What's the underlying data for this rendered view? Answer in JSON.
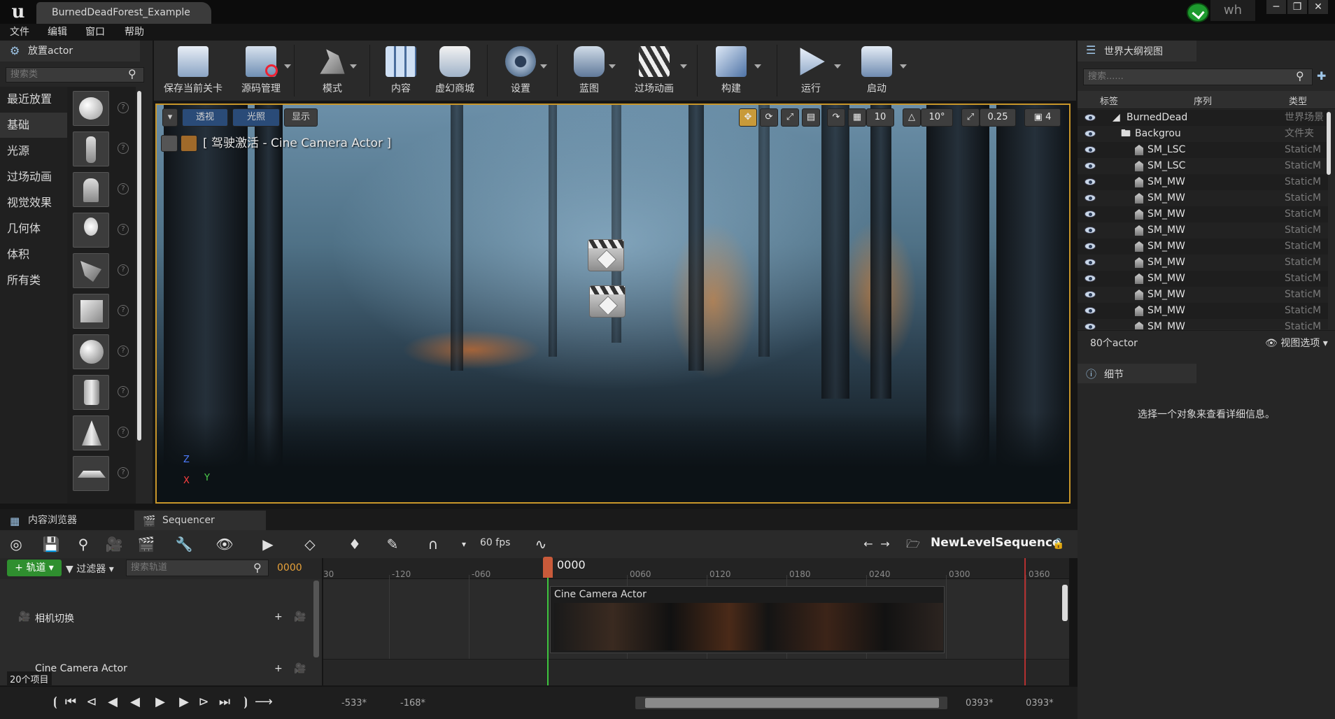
{
  "titlebar": {
    "logo": "u",
    "document_tab": "BurnedDeadForest_Example",
    "user": "wh"
  },
  "menu": [
    "文件",
    "编辑",
    "窗口",
    "帮助"
  ],
  "place_panel": {
    "title": "放置actor",
    "search_placeholder": "搜索类",
    "categories": [
      "最近放置",
      "基础",
      "光源",
      "过场动画",
      "视觉效果",
      "几何体",
      "体积",
      "所有类"
    ],
    "active_category": "基础",
    "help_glyph": "?"
  },
  "toolbar": {
    "buttons": [
      {
        "label": "保存当前关卡",
        "icon": "save-icon"
      },
      {
        "label": "源码管理",
        "icon": "source-control-icon"
      },
      {
        "label": "模式",
        "icon": "modes-icon"
      },
      {
        "label": "内容",
        "icon": "content-icon"
      },
      {
        "label": "虚幻商城",
        "icon": "marketplace-icon"
      },
      {
        "label": "设置",
        "icon": "settings-icon"
      },
      {
        "label": "蓝图",
        "icon": "blueprint-icon"
      },
      {
        "label": "过场动画",
        "icon": "cinematics-icon"
      },
      {
        "label": "构建",
        "icon": "build-icon"
      },
      {
        "label": "运行",
        "icon": "play-icon"
      },
      {
        "label": "启动",
        "icon": "launch-icon"
      }
    ]
  },
  "viewport": {
    "perspective_label": "透视",
    "lit_label": "光照",
    "show_label": "显示",
    "pilot_text": "[ 驾驶激活 - Cine Camera Actor ]",
    "grid_snap": "10",
    "rotation_snap": "10°",
    "scale_snap": "0.25",
    "camera_speed": "4",
    "axis": {
      "z": "Z",
      "y": "Y",
      "x": "X"
    }
  },
  "outliner": {
    "title": "世界大纲视图",
    "search_placeholder": "搜索......",
    "columns": [
      "标签",
      "序列",
      "类型"
    ],
    "rows": [
      {
        "label": "BurnedDead",
        "type": "世界场景"
      },
      {
        "label": "Backgrou",
        "type": "文件夹"
      },
      {
        "label": "SM_LSC",
        "type": "StaticM"
      },
      {
        "label": "SM_LSC",
        "type": "StaticM"
      },
      {
        "label": "SM_MW",
        "type": "StaticM"
      },
      {
        "label": "SM_MW",
        "type": "StaticM"
      },
      {
        "label": "SM_MW",
        "type": "StaticM"
      },
      {
        "label": "SM_MW",
        "type": "StaticM"
      },
      {
        "label": "SM_MW",
        "type": "StaticM"
      },
      {
        "label": "SM_MW",
        "type": "StaticM"
      },
      {
        "label": "SM_MW",
        "type": "StaticM"
      },
      {
        "label": "SM_MW",
        "type": "StaticM"
      },
      {
        "label": "SM_MW",
        "type": "StaticM"
      },
      {
        "label": "SM_MW",
        "type": "StaticM"
      }
    ],
    "actor_count": "80个actor",
    "view_options": "视图选项"
  },
  "details": {
    "title": "细节",
    "empty_message": "选择一个对象来查看详细信息。"
  },
  "bottom_tabs": [
    "内容浏览器",
    "Sequencer"
  ],
  "sequencer": {
    "fps": "60 fps",
    "sequence_name": "NewLevelSequence",
    "add_track": "轨道",
    "filter": "过滤器",
    "search_placeholder": "搜索轨道",
    "current_time": "0000",
    "playhead_time": "0000",
    "tracks": [
      "相机切换",
      "Cine Camera Actor"
    ],
    "item_count": "20个项目",
    "section_label": "Cine Camera Actor",
    "ruler_ticks": [
      "30",
      "-120",
      "-060",
      "0060",
      "0120",
      "0180",
      "0240",
      "0300",
      "0360"
    ],
    "range_start_outer": "-533*",
    "range_start_inner": "-168*",
    "range_end_inner": "0393*",
    "range_end_outer": "0393*"
  }
}
